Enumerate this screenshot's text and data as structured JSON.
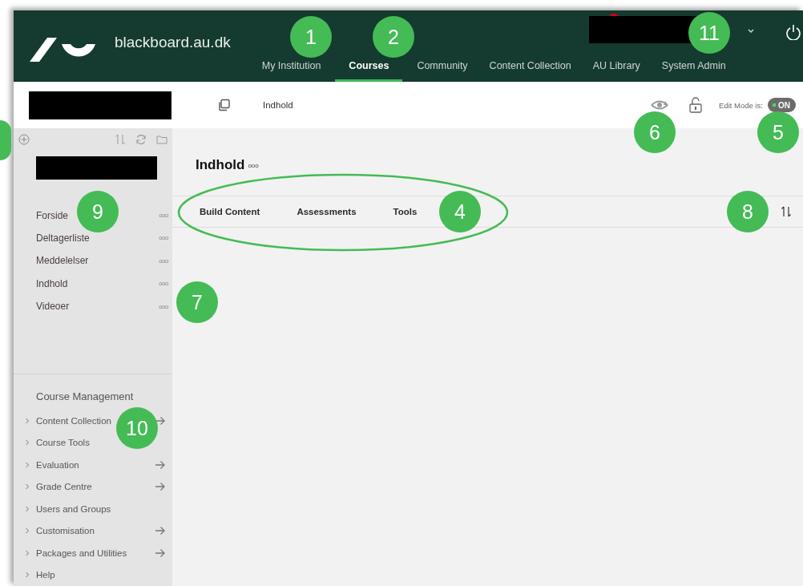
{
  "header": {
    "site_name": "blackboard.au.dk",
    "nav": [
      {
        "label": "My Institution",
        "selected": false
      },
      {
        "label": "Courses",
        "selected": true
      },
      {
        "label": "Community",
        "selected": false
      },
      {
        "label": "Content Collection",
        "selected": false
      },
      {
        "label": "AU Library",
        "selected": false
      },
      {
        "label": "System Admin",
        "selected": false
      }
    ]
  },
  "breadcrumb": {
    "page": "Indhold"
  },
  "edit_mode": {
    "label": "Edit Mode is:",
    "state": "ON",
    "on": true
  },
  "sidebar": {
    "menu": [
      {
        "label": "Forside",
        "more": "ooo"
      },
      {
        "label": "Deltagerliste",
        "more": "ooo"
      },
      {
        "label": "Meddelelser",
        "more": "ooo"
      },
      {
        "label": "Indhold",
        "more": "ooo"
      },
      {
        "label": "Videoer",
        "more": "ooo"
      }
    ],
    "management_title": "Course Management",
    "management": [
      {
        "label": "Content Collection",
        "arrow": true
      },
      {
        "label": "Course Tools",
        "arrow": false
      },
      {
        "label": "Evaluation",
        "arrow": true
      },
      {
        "label": "Grade Centre",
        "arrow": true
      },
      {
        "label": "Users and Groups",
        "arrow": false
      },
      {
        "label": "Customisation",
        "arrow": true
      },
      {
        "label": "Packages and Utilities",
        "arrow": true
      },
      {
        "label": "Help",
        "arrow": false
      }
    ]
  },
  "content": {
    "title": "Indhold",
    "more": "ooo",
    "action_tabs": [
      {
        "label": "Build Content"
      },
      {
        "label": "Assessments"
      },
      {
        "label": "Tools"
      }
    ]
  },
  "callouts": [
    {
      "kind": "partial"
    },
    {
      "kind": "badge",
      "number": "1"
    },
    {
      "kind": "badge",
      "number": "2"
    },
    {
      "kind": "badge",
      "number": "11"
    },
    {
      "kind": "badge",
      "number": "6"
    },
    {
      "kind": "badge",
      "number": "5"
    },
    {
      "kind": "badge",
      "number": "9"
    },
    {
      "kind": "badge",
      "number": "4"
    },
    {
      "kind": "badge",
      "number": "8"
    },
    {
      "kind": "badge",
      "number": "7"
    },
    {
      "kind": "badge",
      "number": "10"
    },
    {
      "kind": "ellipse"
    }
  ]
}
